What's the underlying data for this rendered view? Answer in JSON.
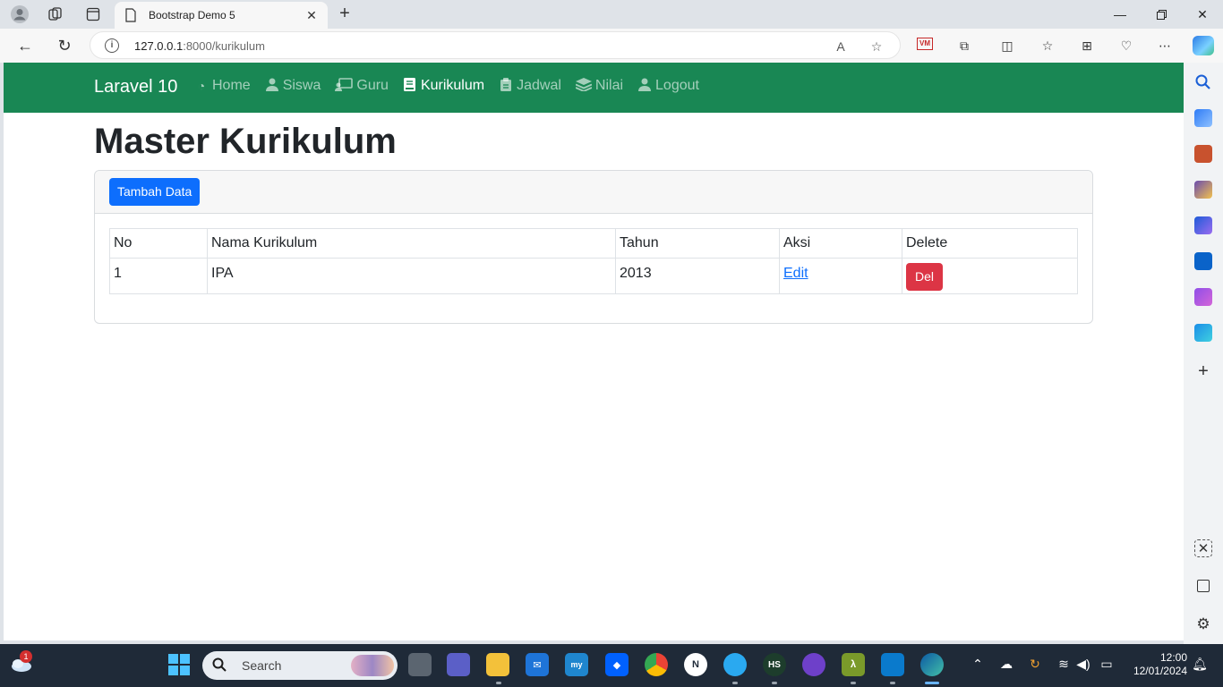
{
  "browser": {
    "tab_title": "Bootstrap Demo 5",
    "url_host": "127.0.0.1",
    "url_path": ":8000/kurikulum",
    "extension_badge": "VM"
  },
  "navbar": {
    "brand": "Laravel 10",
    "links": [
      {
        "label": "Home",
        "icon": "dashboard-icon",
        "active": false
      },
      {
        "label": "Siswa",
        "icon": "user-icon",
        "active": false
      },
      {
        "label": "Guru",
        "icon": "chalkboard-teacher-icon",
        "active": false
      },
      {
        "label": "Kurikulum",
        "icon": "book-icon",
        "active": true
      },
      {
        "label": "Jadwal",
        "icon": "clipboard-icon",
        "active": false
      },
      {
        "label": "Nilai",
        "icon": "layers-icon",
        "active": false
      },
      {
        "label": "Logout",
        "icon": "user-icon",
        "active": false
      }
    ]
  },
  "page": {
    "title": "Master Kurikulum",
    "add_button": "Tambah Data"
  },
  "table": {
    "headers": [
      "No",
      "Nama Kurikulum",
      "Tahun",
      "Aksi",
      "Delete"
    ],
    "rows": [
      {
        "no": "1",
        "nama": "IPA",
        "tahun": "2013",
        "aksi": "Edit",
        "delete": "Del"
      }
    ]
  },
  "taskbar": {
    "search_placeholder": "Search",
    "notification_count": "1",
    "time": "12:00",
    "date": "12/01/2024"
  },
  "colors": {
    "navbar": "#198754",
    "primary": "#0d6efd",
    "danger": "#dc3545"
  }
}
